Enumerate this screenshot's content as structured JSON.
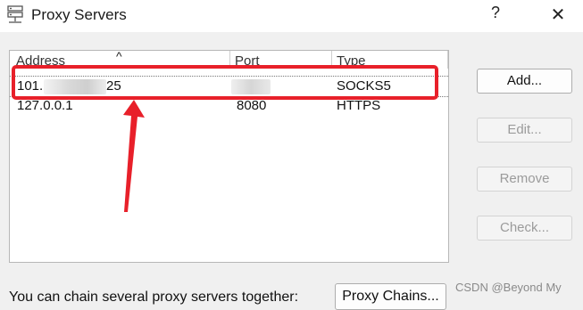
{
  "window": {
    "title": "Proxy Servers",
    "help_glyph": "?",
    "close_glyph": "✕",
    "icon": "server-stack-icon"
  },
  "table": {
    "columns": [
      "Address",
      "Port",
      "Type"
    ],
    "sort_glyph": "^",
    "rows": [
      {
        "address_start": "101.",
        "address_end": "25",
        "port": "",
        "type": "SOCKS5"
      },
      {
        "address": "127.0.0.1",
        "port": "8080",
        "type": "HTTPS"
      }
    ]
  },
  "buttons": {
    "add": "Add...",
    "edit": "Edit...",
    "remove": "Remove",
    "check": "Check..."
  },
  "chain": {
    "label": "You can chain several proxy servers together:",
    "button": "Proxy Chains..."
  },
  "annotation": {
    "color": "#e8202a"
  },
  "watermark": "CSDN @Beyond My"
}
